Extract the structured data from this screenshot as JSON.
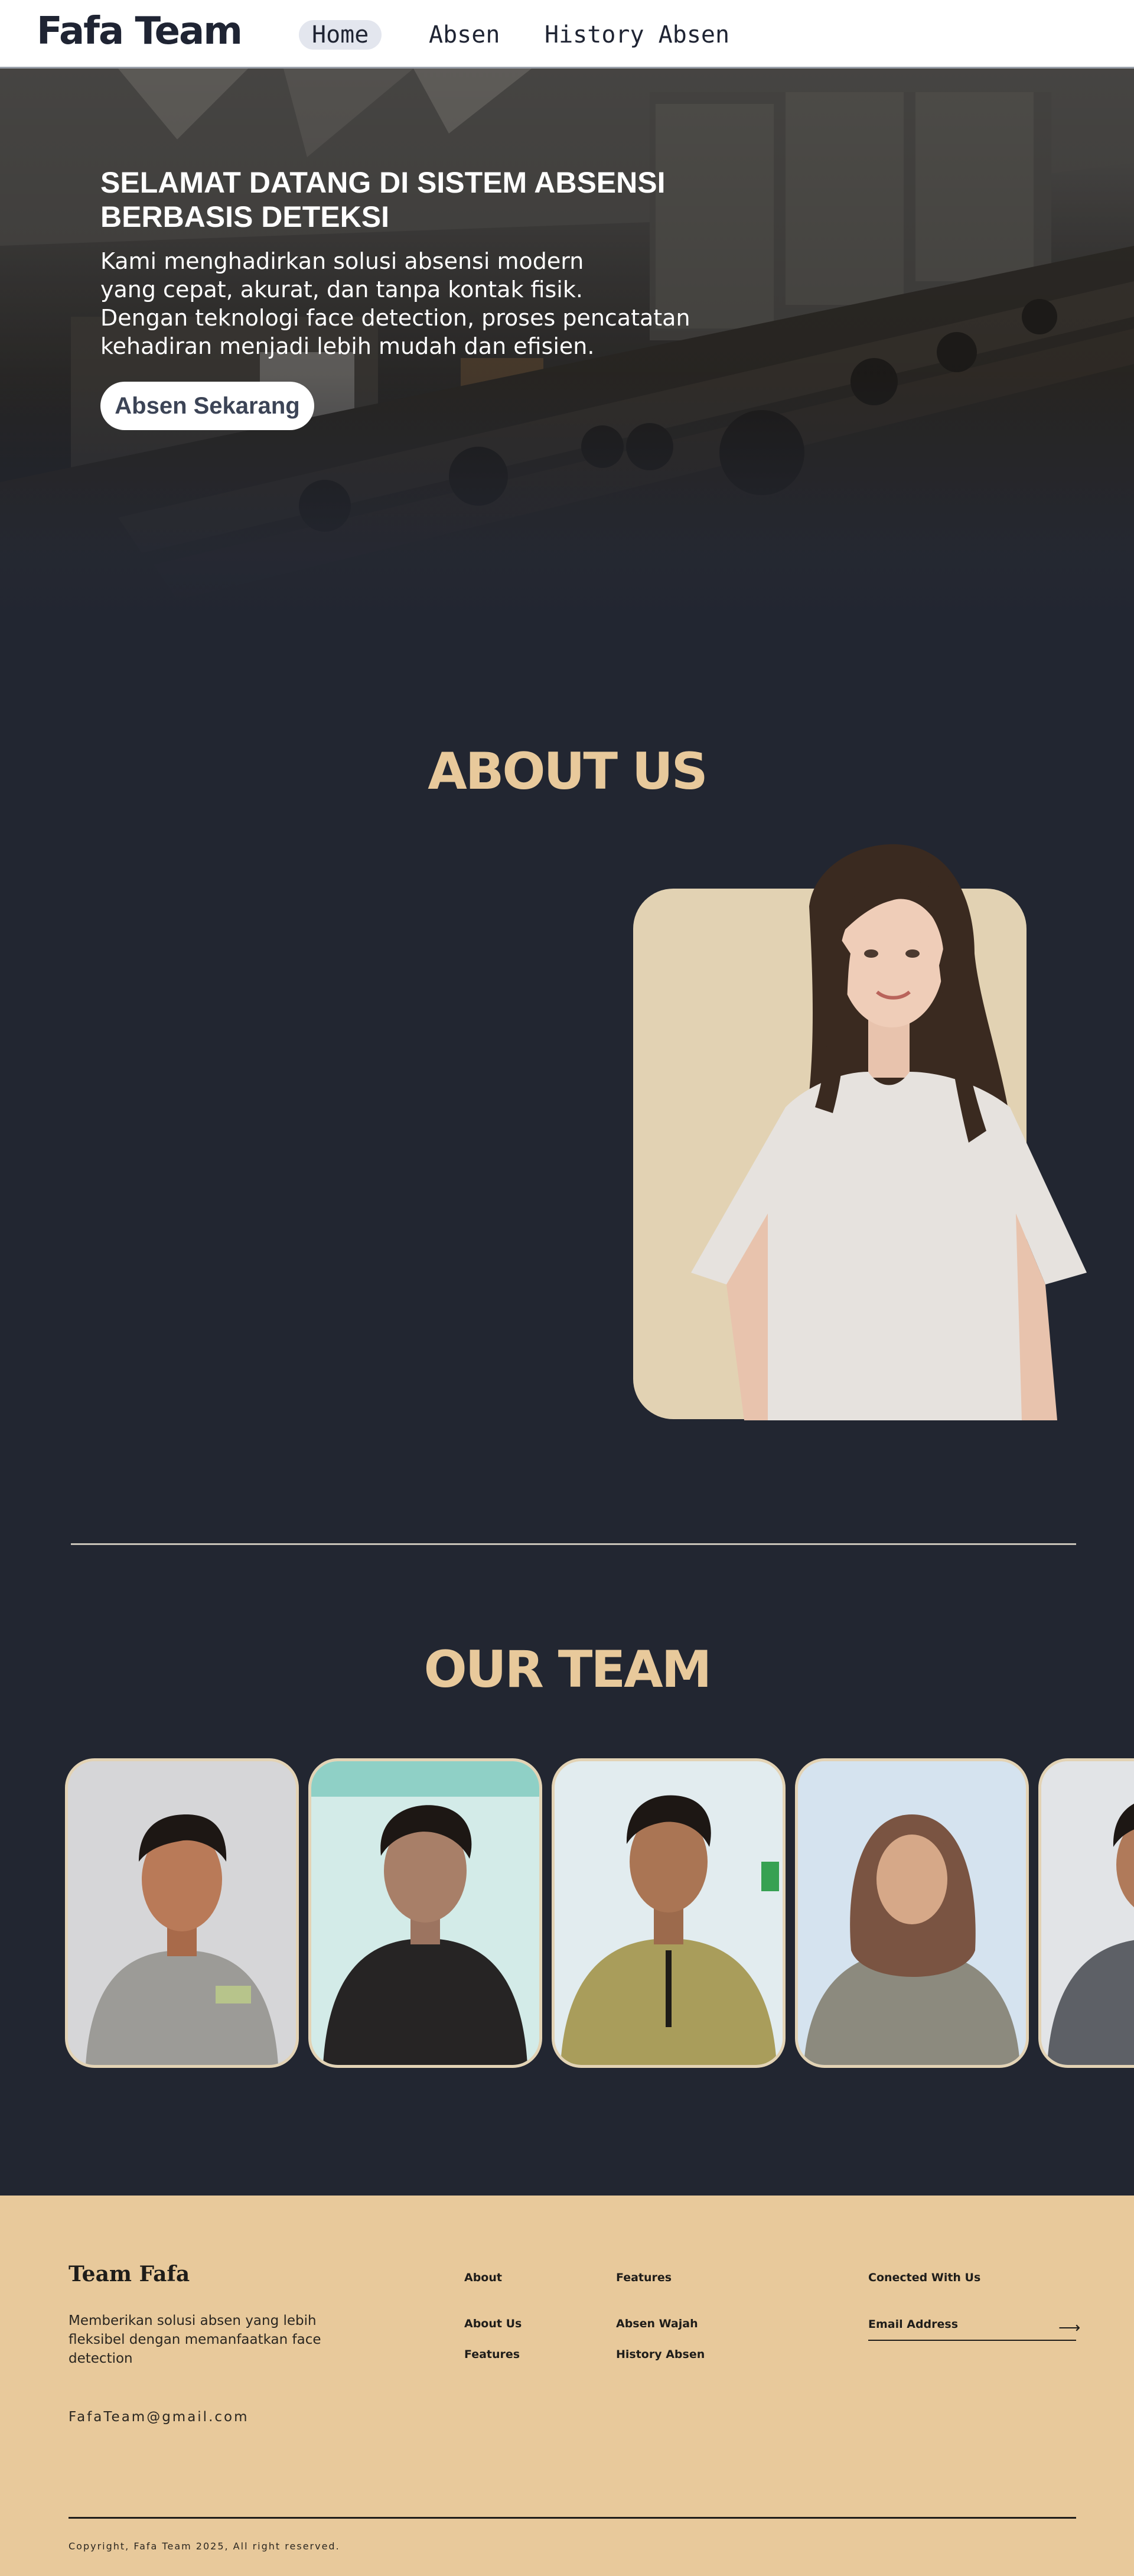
{
  "nav": {
    "brand": "Fafa Team",
    "links": [
      {
        "label": "Home",
        "active": true
      },
      {
        "label": "Absen",
        "active": false
      },
      {
        "label": "History Absen",
        "active": false
      }
    ]
  },
  "hero": {
    "title": "SELAMAT DATANG DI SISTEM ABSENSI BERBASIS DETEKSI",
    "desc_lines": [
      "Kami menghadirkan solusi absensi modern",
      "yang cepat, akurat, dan tanpa kontak fisik.",
      "Dengan teknologi face detection, proses pencatatan",
      "kehadiran menjadi lebih mudah dan efisien."
    ],
    "cta": "Absen Sekarang"
  },
  "about": {
    "title": "ABOUT US"
  },
  "team": {
    "title": "OUR TEAM",
    "members": [
      {
        "shirt": "grey-hoodie"
      },
      {
        "shirt": "black-shirt"
      },
      {
        "shirt": "olive-polo"
      },
      {
        "shirt": "grey-shirt-hijab"
      },
      {
        "shirt": "grey-polo"
      }
    ]
  },
  "footer": {
    "brand": "Team Fafa",
    "desc": "Memberikan solusi absen yang lebih fleksibel dengan memanfaatkan face detection",
    "email": "FafaTeam@gmail.com",
    "col_about": {
      "heading": "About",
      "links": [
        "About Us",
        "Features"
      ]
    },
    "col_features": {
      "heading": "Features",
      "links": [
        "Absen Wajah",
        "History Absen"
      ]
    },
    "col_connect": {
      "heading": "Conected With Us",
      "placeholder": "Email Address"
    },
    "copyright": "Copyright, Fafa Team 2025, All right reserved."
  },
  "colors": {
    "accent": "#e8c99b",
    "background": "#222631",
    "navbar": "#ffffff",
    "footer": "#e8c99b"
  }
}
